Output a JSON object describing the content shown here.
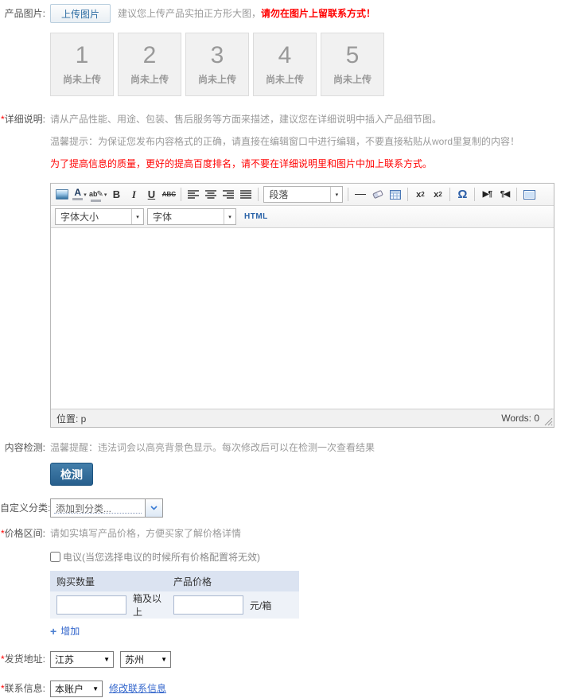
{
  "glyphs": {
    "caret_down": "▼",
    "combo_caret": "▾",
    "plus": "+"
  },
  "colors": {
    "warning_red": "#ff0000",
    "link_blue": "#3366cc",
    "check_button_blue": "#2f6e9e",
    "table_header_bg": "#dbe3f1",
    "table_row_bg": "#eef2f8"
  },
  "icons": [
    "image-icon",
    "font-color-icon",
    "highlight-icon",
    "align-left-icon",
    "align-center-icon",
    "align-right-icon",
    "align-justify-icon",
    "hr-icon",
    "eraser-icon",
    "table-icon",
    "fullscreen-icon",
    "resize-grip-icon",
    "chevron-down-icon",
    "plus-icon"
  ],
  "product_image": {
    "label": {
      "star": "",
      "text": "产品图片:"
    },
    "button": "上传图片",
    "hint_gray": "建议您上传产品实拍正方形大图，",
    "hint_red": "请勿在图片上留联系方式！",
    "slots": [
      {
        "number": "1",
        "status": "尚未上传"
      },
      {
        "number": "2",
        "status": "尚未上传"
      },
      {
        "number": "3",
        "status": "尚未上传"
      },
      {
        "number": "4",
        "status": "尚未上传"
      },
      {
        "number": "5",
        "status": "尚未上传"
      }
    ]
  },
  "description": {
    "label": {
      "star": "*",
      "text": "详细说明:"
    },
    "hint": "请从产品性能、用途、包装、售后服务等方面来描述，建议您在详细说明中插入产品细节图。",
    "tip": "温馨提示：为保证您发布内容格式的正确，请直接在编辑窗口中进行编辑，不要直接粘贴从word里复制的内容！",
    "warning": "为了提高信息的质量，更好的提高百度排名，请不要在详细说明里和图片中加上联系方式。"
  },
  "editor": {
    "toolbar": {
      "bold": "B",
      "italic": "I",
      "underline": "U",
      "strike": "ABC",
      "format_value": "段落",
      "fontsize_value": "字体大小",
      "fontname_value": "字体",
      "html_label": "HTML",
      "sub_base": "x",
      "sub_digit": "2",
      "sup_base": "x",
      "sup_digit": "2",
      "omega": "Ω",
      "ltr": "▶¶",
      "rtl": "¶◀",
      "highlight_ab": "ab",
      "highlight_pen": "✎",
      "fontcolor_a": "A"
    },
    "statusbar": {
      "position": "位置: p",
      "words": "Words: 0"
    }
  },
  "content_check": {
    "label": {
      "star": "",
      "text": "内容检测:"
    },
    "hint": "温馨提醒：违法词会以高亮背景色显示。每次修改后可以在检测一次查看结果",
    "button": "检测"
  },
  "custom_category": {
    "label": {
      "star": "",
      "text": "自定义分类:"
    },
    "value": "添加到分类..."
  },
  "price_range": {
    "label": {
      "star": "*",
      "text": "价格区间:"
    },
    "hint": "请如实填写产品价格，方便买家了解价格详情",
    "negotiable_label": "电议(当您选择电议的时候所有价格配置将无效)",
    "table": {
      "headers": [
        "购买数量",
        "产品价格"
      ],
      "qty_suffix": "箱及以上",
      "price_suffix": "元/箱"
    },
    "add_link": "增加"
  },
  "shipping": {
    "label": {
      "star": "*",
      "text": "发货地址:"
    },
    "province": "江苏",
    "city": "苏州"
  },
  "contact": {
    "label": {
      "star": "*",
      "text": "联系信息:"
    },
    "account": "本账户",
    "edit_link": "修改联系信息"
  }
}
